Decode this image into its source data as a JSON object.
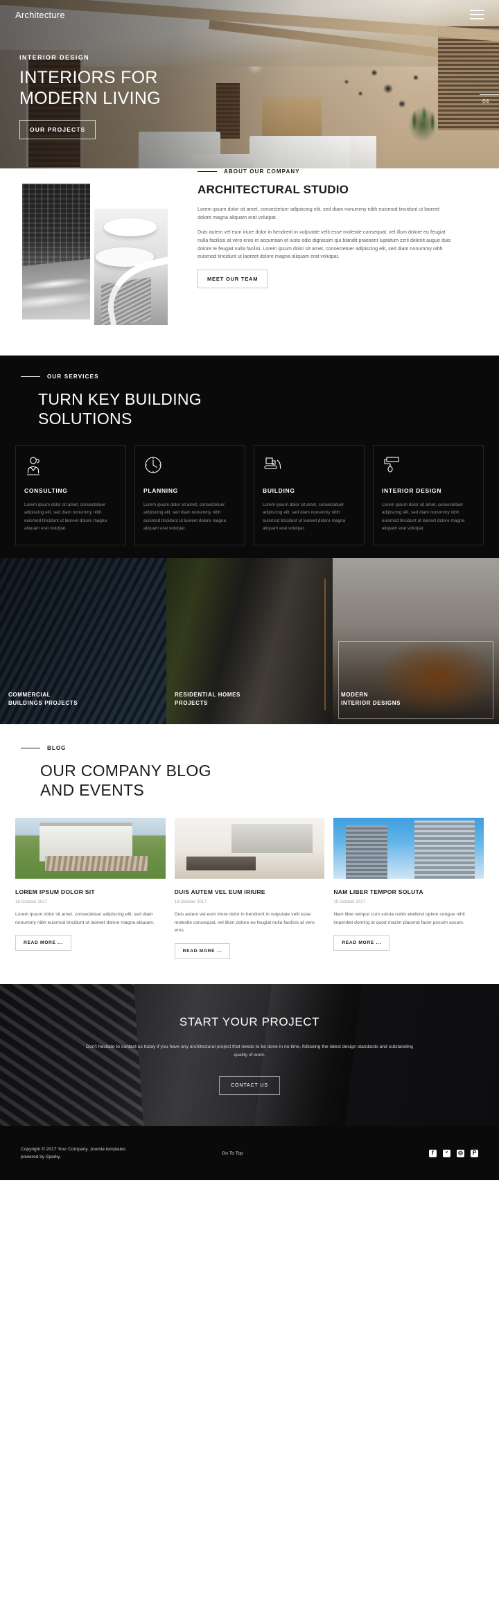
{
  "header": {
    "brand": "Architecture",
    "menu_icon": "hamburger-icon"
  },
  "hero": {
    "eyebrow": "INTERIOR DESIGN",
    "title": "INTERIORS FOR\nMODERN LIVING",
    "button": "OUR PROJECTS",
    "slide_number": "04"
  },
  "about": {
    "eyebrow": "ABOUT OUR COMPANY",
    "heading": "ARCHITECTURAL STUDIO",
    "paragraph1": "Lorem ipsum dolor sit amet, consectetuer adipiscing elit, sed diam nonummy nibh euismod tincidunt ut laoreet dolore magna aliquam erat volutpat.",
    "paragraph2": "Duis autem vel eum iriure dolor in hendrerit in vulputate velit esse molestie consequat, vel illum dolore eu feugiat nulla facilisis at vero eros et accumsan et iusto odio dignissim qui blandit praesent luptatum zzril delenit augue duis dolore te feugait nulla facilisi. Lorem ipsum dolor sit amet, consectetuer adipiscing elit, sed diam nonummy nibh euismod tincidunt ut laoreet dolore magna aliquam erat volutpat.",
    "button": "MEET OUR TEAM"
  },
  "services": {
    "eyebrow": "OUR SERVICES",
    "heading": "TURN KEY BUILDING\nSOLUTIONS",
    "body_text": "Lorem ipsum dolor sit amet, consectetuer adipiscing elit, sed diam nonummy nibh euismod tincidunt ut laoreet dolore magna aliquam erat volutpat.",
    "cards": [
      {
        "icon": "consulting-person-icon",
        "title": "CONSULTING"
      },
      {
        "icon": "clock-icon",
        "title": "PLANNING"
      },
      {
        "icon": "bulldozer-icon",
        "title": "BUILDING"
      },
      {
        "icon": "paint-roller-icon",
        "title": "INTERIOR DESIGN"
      }
    ]
  },
  "gallery": [
    {
      "label": "COMMERCIAL\nBUILDINGS PROJECTS"
    },
    {
      "label": "RESIDENTIAL HOMES\nPROJECTS"
    },
    {
      "label": "MODERN\nINTERIOR DESIGNS"
    }
  ],
  "blog": {
    "eyebrow": "BLOG",
    "heading": "OUR COMPANY BLOG\nAND EVENTS",
    "read_more": "READ MORE ...",
    "posts": [
      {
        "title": "LOREM IPSUM DOLOR SIT",
        "date": "19 October 2017",
        "excerpt": "Lorem ipsum dolor sit amet, consectetuer adipiscing elit, sed diam nonummy nibh euismod tincidunt ut laoreet dolore magna aliquam."
      },
      {
        "title": "DUIS AUTEM VEL EUM IRIURE",
        "date": "19 October 2017",
        "excerpt": "Duis autem vel eum iriure dolor in hendrerit in vulputate velit esse molestie consequat, vel illum dolore eu feugiat nulla facilisis at vero eros."
      },
      {
        "title": "NAM LIBER TEMPOR SOLUTA",
        "date": "19 October 2017",
        "excerpt": "Nam liber tempor cum soluta nobis eleifend option congue nihil imperdiet doming id quod mazim placerat facer possim assum."
      }
    ]
  },
  "cta": {
    "title": "START YOUR PROJECT",
    "text": "Don't hesitate to contact us today if you have any architectural project that needs to be done in no time, following the latest design standards and outstanding quality of work.",
    "button": "CONTACT US"
  },
  "footer": {
    "copyright": "Copyright © 2017 Your Company. Joomla templates\npowered by Sparky.",
    "go_to_top": "Go To Top",
    "social": [
      {
        "name": "facebook-icon",
        "glyph": "f"
      },
      {
        "name": "twitter-icon",
        "glyph": "ᵛ"
      },
      {
        "name": "instagram-icon",
        "glyph": "◎"
      },
      {
        "name": "pinterest-icon",
        "glyph": "P"
      }
    ]
  },
  "colors": {
    "dark": "#0a0a0a",
    "light": "#ffffff",
    "muted": "#8d8d8d"
  }
}
